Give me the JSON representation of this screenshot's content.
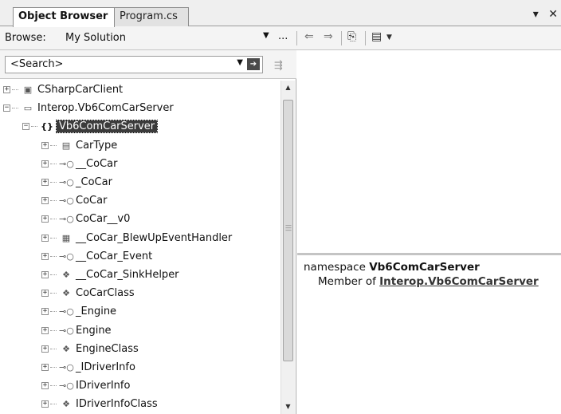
{
  "tabs": [
    {
      "label": "Object Browser",
      "active": true
    },
    {
      "label": "Program.cs",
      "active": false
    }
  ],
  "window_buttons": {
    "dropdown": "▾",
    "close": "✕"
  },
  "browse": {
    "label": "Browse:",
    "value": "My Solution",
    "ellipsis": "..."
  },
  "search": {
    "placeholder": "<Search>"
  },
  "tree": [
    {
      "label": "CSharpCarClient",
      "icon": "project-icon",
      "glyph": "▣",
      "level": 0,
      "expander": "+"
    },
    {
      "label": "Interop.Vb6ComCarServer",
      "icon": "assembly-icon",
      "glyph": "▭",
      "level": 0,
      "expander": "−"
    },
    {
      "label": "Vb6ComCarServer",
      "icon": "namespace-icon",
      "glyph": "{}",
      "level": 1,
      "expander": "−",
      "selected": true
    },
    {
      "label": "CarType",
      "icon": "enum-icon",
      "glyph": "▤",
      "level": 2,
      "expander": "+"
    },
    {
      "label": "__CoCar",
      "icon": "interface-icon",
      "glyph": "⊸○",
      "level": 2,
      "expander": "+"
    },
    {
      "label": "_CoCar",
      "icon": "interface-icon",
      "glyph": "⊸○",
      "level": 2,
      "expander": "+"
    },
    {
      "label": "CoCar",
      "icon": "interface-icon",
      "glyph": "⊸○",
      "level": 2,
      "expander": "+"
    },
    {
      "label": "CoCar__v0",
      "icon": "interface-icon",
      "glyph": "⊸○",
      "level": 2,
      "expander": "+"
    },
    {
      "label": "__CoCar_BlewUpEventHandler",
      "icon": "delegate-icon",
      "glyph": "▦",
      "level": 2,
      "expander": "+"
    },
    {
      "label": "__CoCar_Event",
      "icon": "interface-icon",
      "glyph": "⊸○",
      "level": 2,
      "expander": "+"
    },
    {
      "label": "__CoCar_SinkHelper",
      "icon": "class-icon",
      "glyph": "❖",
      "level": 2,
      "expander": "+"
    },
    {
      "label": "CoCarClass",
      "icon": "class-icon",
      "glyph": "❖",
      "level": 2,
      "expander": "+"
    },
    {
      "label": "_Engine",
      "icon": "interface-icon",
      "glyph": "⊸○",
      "level": 2,
      "expander": "+"
    },
    {
      "label": "Engine",
      "icon": "interface-icon",
      "glyph": "⊸○",
      "level": 2,
      "expander": "+"
    },
    {
      "label": "EngineClass",
      "icon": "class-icon",
      "glyph": "❖",
      "level": 2,
      "expander": "+"
    },
    {
      "label": "_IDriverInfo",
      "icon": "interface-icon",
      "glyph": "⊸○",
      "level": 2,
      "expander": "+"
    },
    {
      "label": "IDriverInfo",
      "icon": "interface-icon",
      "glyph": "⊸○",
      "level": 2,
      "expander": "+"
    },
    {
      "label": "IDriverInfoClass",
      "icon": "class-icon",
      "glyph": "❖",
      "level": 2,
      "expander": "+"
    }
  ],
  "description": {
    "keyword": "namespace",
    "name": "Vb6ComCarServer",
    "member_of_label": "Member of",
    "member_of_link": "Interop.Vb6ComCarServer"
  }
}
